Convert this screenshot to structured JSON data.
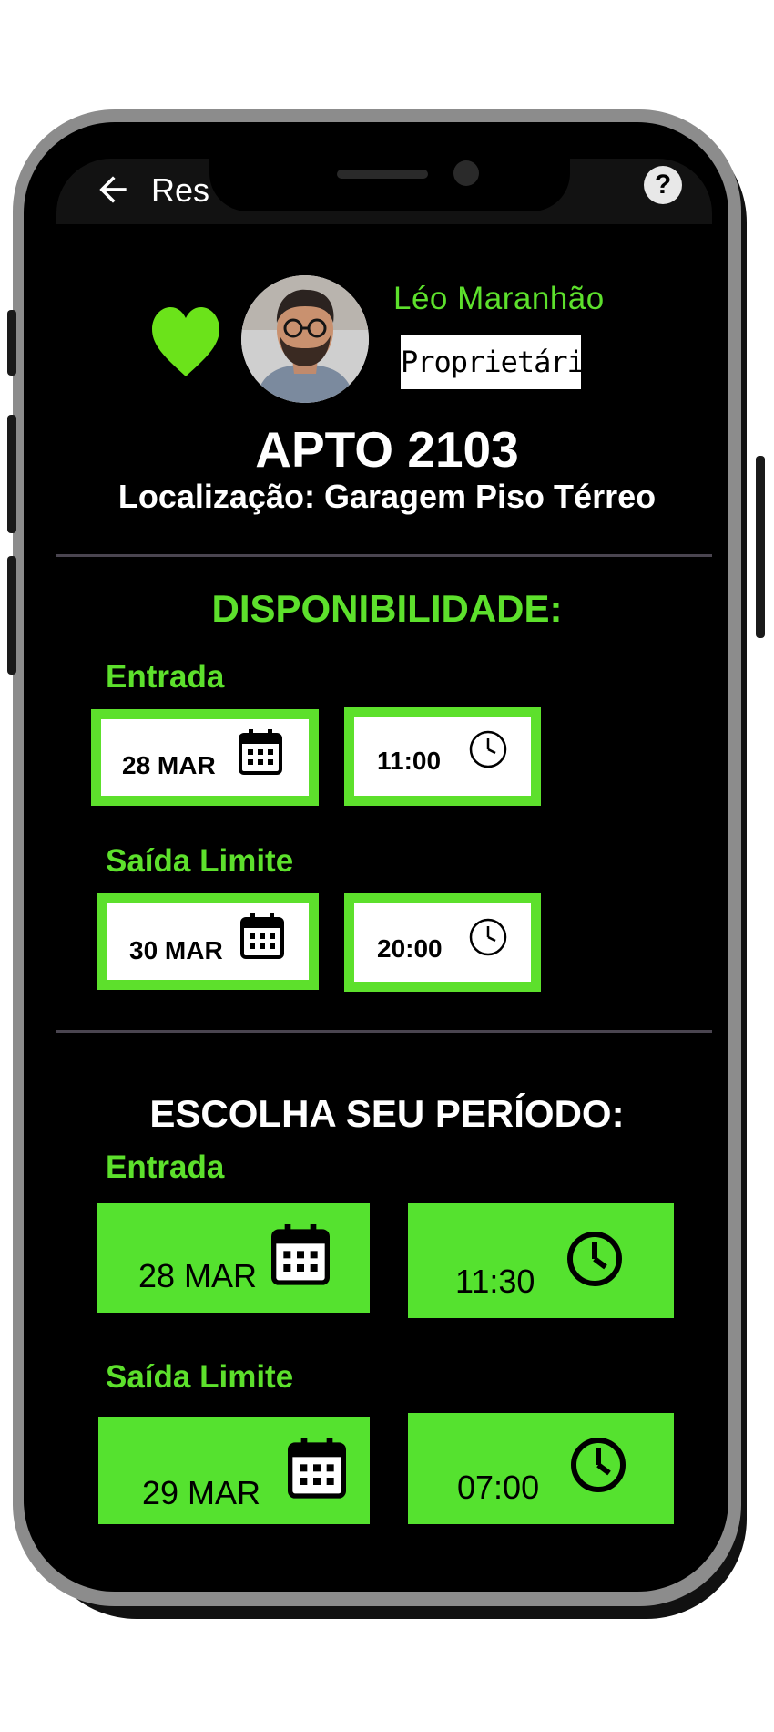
{
  "header": {
    "title": "Res",
    "back_icon": "arrow-left-icon",
    "help_icon": "help-icon",
    "help_glyph": "?"
  },
  "owner": {
    "name": "Léo Maranhão",
    "role": "Proprietário",
    "favorite_icon": "heart-icon"
  },
  "unit": {
    "title": "APTO 2103",
    "location": "Localização: Garagem Piso Térreo"
  },
  "availability": {
    "title": "DISPONIBILIDADE:",
    "entry_label": "Entrada",
    "entry_date": "28 MAR",
    "entry_time": "11:00",
    "exit_label": "Saída Limite",
    "exit_date": "30 MAR",
    "exit_time": "20:00"
  },
  "choose": {
    "title": "ESCOLHA SEU PERÍODO:",
    "entry_label": "Entrada",
    "entry_date": "28 MAR",
    "entry_time": "11:30",
    "exit_label": "Saída Limite",
    "exit_date": "29 MAR",
    "exit_time": "07:00"
  },
  "colors": {
    "accent_green": "#5de02c",
    "background": "#000000",
    "frame": "#8c8c8c"
  }
}
